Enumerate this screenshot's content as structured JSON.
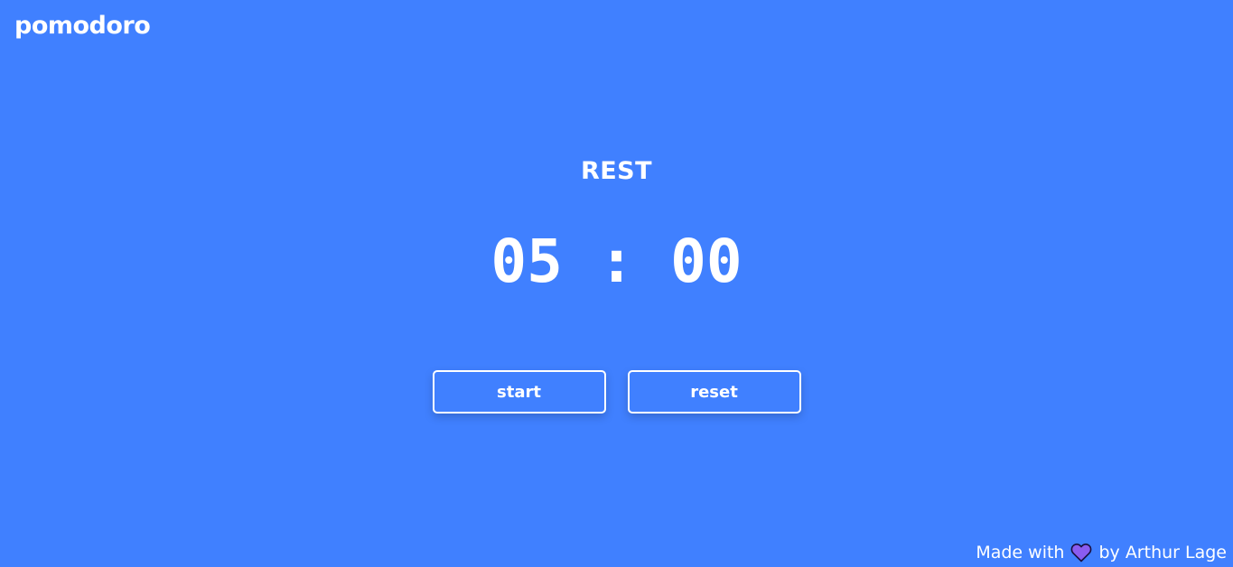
{
  "header": {
    "brand": "pomodoro"
  },
  "timer": {
    "mode": "REST",
    "minutes": "05",
    "separator": ":",
    "seconds": "00"
  },
  "controls": {
    "start_label": "start",
    "reset_label": "reset"
  },
  "footer": {
    "prefix": "Made with",
    "suffix": "by Arthur Lage",
    "icon": "heart-icon"
  },
  "colors": {
    "background": "#4080ff",
    "text": "#ffffff",
    "heart": "#8a5cf0"
  }
}
